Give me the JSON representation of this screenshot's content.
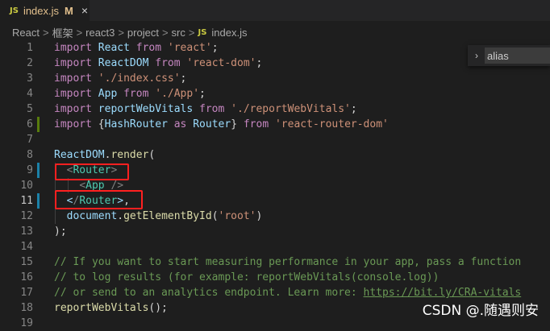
{
  "tab": {
    "icon_label": "JS",
    "file_name": "index.js",
    "status": "M",
    "close": "×"
  },
  "breadcrumb": {
    "parts": [
      "React",
      "框架",
      "react3",
      "project",
      "src"
    ],
    "separator": ">",
    "file_icon_label": "JS",
    "file": "index.js"
  },
  "find_widget": {
    "value": "alias",
    "toggle": "›"
  },
  "code": {
    "lines": [
      {
        "n": "1",
        "tokens": [
          [
            "kw",
            "import"
          ],
          [
            "",
            "␣"
          ],
          [
            "var",
            "React"
          ],
          [
            "",
            "␣"
          ],
          [
            "kw",
            "from"
          ],
          [
            "",
            "␣"
          ],
          [
            "str",
            "'react'"
          ],
          [
            "",
            ";"
          ]
        ]
      },
      {
        "n": "2",
        "tokens": [
          [
            "kw",
            "import"
          ],
          [
            "",
            "␣"
          ],
          [
            "var",
            "ReactDOM"
          ],
          [
            "",
            "␣"
          ],
          [
            "kw",
            "from"
          ],
          [
            "",
            "␣"
          ],
          [
            "str",
            "'react-dom'"
          ],
          [
            "",
            ";"
          ]
        ]
      },
      {
        "n": "3",
        "tokens": [
          [
            "kw",
            "import"
          ],
          [
            "",
            "␣"
          ],
          [
            "str",
            "'./index.css'"
          ],
          [
            "",
            ";"
          ]
        ]
      },
      {
        "n": "4",
        "tokens": [
          [
            "kw",
            "import"
          ],
          [
            "",
            "␣"
          ],
          [
            "var",
            "App"
          ],
          [
            "",
            "␣"
          ],
          [
            "kw",
            "from"
          ],
          [
            "",
            "␣"
          ],
          [
            "str",
            "'./App'"
          ],
          [
            "",
            ";"
          ]
        ]
      },
      {
        "n": "5",
        "tokens": [
          [
            "kw",
            "import"
          ],
          [
            "",
            "␣"
          ],
          [
            "var",
            "reportWebVitals"
          ],
          [
            "",
            "␣"
          ],
          [
            "kw",
            "from"
          ],
          [
            "",
            "␣"
          ],
          [
            "str",
            "'./reportWebVitals'"
          ],
          [
            "",
            ";"
          ]
        ]
      },
      {
        "n": "6",
        "tokens": [
          [
            "kw",
            "import"
          ],
          [
            "",
            "␣{"
          ],
          [
            "var",
            "HashRouter"
          ],
          [
            "",
            "␣"
          ],
          [
            "kw",
            "as"
          ],
          [
            "",
            "␣"
          ],
          [
            "var",
            "Router"
          ],
          [
            "",
            "}␣"
          ],
          [
            "kw",
            "from"
          ],
          [
            "",
            "␣"
          ],
          [
            "str",
            "'react-router-dom'"
          ]
        ]
      },
      {
        "n": "7",
        "tokens": []
      },
      {
        "n": "8",
        "tokens": [
          [
            "var",
            "ReactDOM"
          ],
          [
            "",
            "."
          ],
          [
            "fn",
            "render"
          ],
          [
            "",
            "("
          ]
        ]
      },
      {
        "n": "9",
        "tokens": [
          [
            "",
            "␣␣"
          ],
          [
            "brk",
            "<"
          ],
          [
            "tag",
            "Router"
          ],
          [
            "brk",
            ">"
          ]
        ]
      },
      {
        "n": "10",
        "tokens": [
          [
            "",
            "␣␣␣␣"
          ],
          [
            "brk",
            "<"
          ],
          [
            "tag",
            "App"
          ],
          [
            "",
            "␣"
          ],
          [
            "brk",
            "/>"
          ]
        ]
      },
      {
        "n": "11",
        "tokens": [
          [
            "",
            "␣␣"
          ],
          [
            "bx",
            "<"
          ],
          [
            "brk",
            "/"
          ],
          [
            "tag",
            "Router"
          ],
          [
            "bx",
            ">"
          ],
          [
            "",
            ","
          ]
        ]
      },
      {
        "n": "12",
        "tokens": [
          [
            "",
            "␣␣"
          ],
          [
            "var",
            "document"
          ],
          [
            "",
            "."
          ],
          [
            "fn",
            "getElementById"
          ],
          [
            "",
            "("
          ],
          [
            "str",
            "'root'"
          ],
          [
            "",
            ")"
          ]
        ]
      },
      {
        "n": "13",
        "tokens": [
          [
            "",
            ");"
          ]
        ]
      },
      {
        "n": "14",
        "tokens": []
      },
      {
        "n": "15",
        "tokens": [
          [
            "cm",
            "// If you want to start measuring performance in your app, pass a function"
          ]
        ]
      },
      {
        "n": "16",
        "tokens": [
          [
            "cm",
            "// to log results (for example: reportWebVitals(console.log))"
          ]
        ]
      },
      {
        "n": "17",
        "tokens": [
          [
            "cm",
            "// or send to an analytics endpoint. Learn more: "
          ],
          [
            "lnk",
            "https://bit.ly/CRA-vitals"
          ]
        ]
      },
      {
        "n": "18",
        "tokens": [
          [
            "fn",
            "reportWebVitals"
          ],
          [
            "",
            "();"
          ]
        ]
      },
      {
        "n": "19",
        "tokens": []
      }
    ],
    "active_line": "11"
  },
  "watermark": "CSDN @.随遇则安",
  "colors": {
    "background": "#1e1e1e",
    "keyword": "#c586c0",
    "variable": "#9cdcfe",
    "string": "#ce9178",
    "function": "#dcdcaa",
    "tag": "#4ec9b0",
    "comment": "#6a9955",
    "highlight_box": "#ff2020",
    "modified_gutter": "#1b81a8",
    "added_gutter": "#587c0c"
  }
}
